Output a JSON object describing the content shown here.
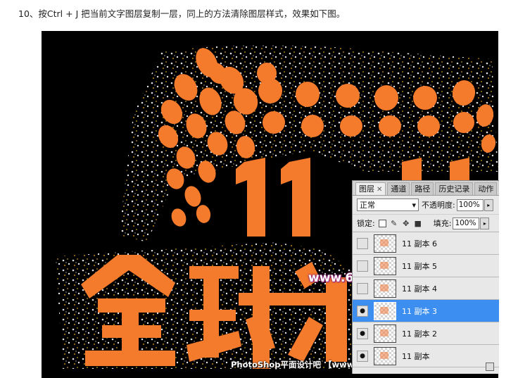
{
  "caption": "10、按Ctrl + J 把当前文字图层复制一层，同上的方法清除图层样式，效果如下图。",
  "artwork": {
    "big_number": "11",
    "big_text": "全球",
    "accent_color": "#f47a2c",
    "background_color": "#000000"
  },
  "watermark": "www.68ps.com",
  "footer_credit": "PhotoShop平面设计吧 【www.linecg.com/tieba/1783】",
  "panel": {
    "tabs": [
      {
        "label": "图层",
        "close": "✕"
      },
      {
        "label": "通道"
      },
      {
        "label": "路径"
      },
      {
        "label": "历史记录"
      },
      {
        "label": "动作"
      }
    ],
    "blend_mode": "正常",
    "opacity_label": "不透明度:",
    "opacity_value": "100%",
    "lock_label": "锁定:",
    "fill_label": "填充:",
    "fill_value": "100%",
    "layers": [
      {
        "name": "11 副本 6",
        "visible": false,
        "selected": false
      },
      {
        "name": "11 副本 5",
        "visible": false,
        "selected": false
      },
      {
        "name": "11 副本 4",
        "visible": false,
        "selected": false
      },
      {
        "name": "11 副本 3",
        "visible": true,
        "selected": true
      },
      {
        "name": "11 副本 2",
        "visible": true,
        "selected": false
      },
      {
        "name": "11 副本",
        "visible": true,
        "selected": false
      }
    ],
    "selected_color": "#3c8ff0"
  }
}
